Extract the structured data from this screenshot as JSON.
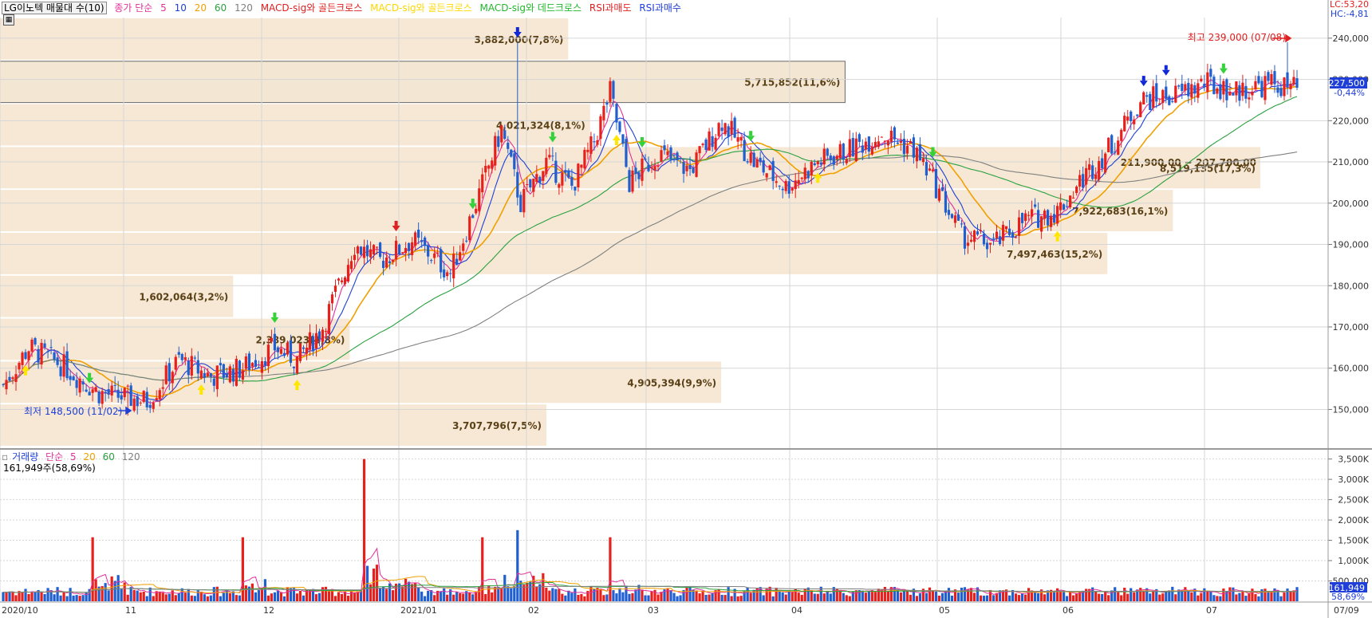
{
  "legend": {
    "stock": "LG이노텍 매물대 수(10)",
    "ma_label": "종가 단순",
    "ma_periods": [
      "5",
      "10",
      "20",
      "60",
      "120"
    ],
    "ma_colors": [
      "#e0309a",
      "#1f3fd8",
      "#f0a000",
      "#2aa040",
      "#808080"
    ],
    "sig1": "MACD-sig와 골든크로스",
    "sig2": "MACD-sig와 골든크로스",
    "sig3": "MACD-sig와 데드크로스",
    "sig4": "RSI과매도",
    "sig5": "RSI과매수"
  },
  "right_info": {
    "lc": "LC:53,20",
    "hc": "HC:-4,81"
  },
  "current": {
    "price": "227,500",
    "change": "-0,44%"
  },
  "annotations": {
    "high": "최고 239,000 (07/08)",
    "low": "최저 148,500 (11/02)"
  },
  "volume_legend": {
    "title": "거래량",
    "ma_label": "단순",
    "periods": [
      "5",
      "20",
      "60",
      "120"
    ],
    "info": "161,949주(58,69%)",
    "current": "161,949",
    "current_pct": "58,69%"
  },
  "chart_data": {
    "type": "candlestick",
    "title": "LG이노텍 매물대 수(10)",
    "price_axis": {
      "range": [
        141000,
        245000
      ],
      "ticks": [
        150000,
        160000,
        170000,
        180000,
        190000,
        200000,
        210000,
        220000,
        230000,
        240000
      ],
      "tick_labels": [
        "150,000",
        "160,000",
        "170,000",
        "180,000",
        "190,000",
        "200,000",
        "210,000",
        "220,000",
        "230,000",
        "240,000"
      ]
    },
    "volume_axis": {
      "range": [
        0,
        3650000
      ],
      "ticks": [
        500000,
        1000000,
        1500000,
        2000000,
        2500000,
        3000000,
        3500000
      ],
      "tick_labels": [
        "500,000",
        "1,000K",
        "1,500K",
        "2,000K",
        "2,500K",
        "3,000K",
        "3,500K"
      ]
    },
    "x_labels": [
      "2020/10",
      "11",
      "12",
      "2021/01",
      "02",
      "03",
      "04",
      "05",
      "06",
      "07",
      "07/09"
    ],
    "volume_profile": [
      {
        "low": 141000,
        "high": 151400,
        "label": "3,707,796(7,5%)"
      },
      {
        "low": 151400,
        "high": 161800,
        "label": "4,905,394(9,9%)"
      },
      {
        "low": 161800,
        "high": 172200,
        "label": "2,389,023(4,8%)"
      },
      {
        "low": 172200,
        "high": 182600,
        "label": "1,602,064(3,2%)"
      },
      {
        "low": 182600,
        "high": 193000,
        "label": "7,497,463(15,2%)"
      },
      {
        "low": 193000,
        "high": 203400,
        "label": "7,922,683(16,1%)"
      },
      {
        "low": 203400,
        "high": 213800,
        "label": "8,519,135(17,3%)"
      },
      {
        "low": 213800,
        "high": 224200,
        "label": "4,021,324(8,1%)"
      },
      {
        "low": 224200,
        "high": 234600,
        "label": "5,715,852(11,6%)"
      },
      {
        "low": 234600,
        "high": 245000,
        "label": "3,882,000(7,8%)"
      }
    ],
    "dominant_band": "211,900,00 ~ 207,700,00",
    "price_waypoints": [
      [
        0,
        156000
      ],
      [
        8,
        165000
      ],
      [
        18,
        161000
      ],
      [
        30,
        154000
      ],
      [
        45,
        152000
      ],
      [
        55,
        162000
      ],
      [
        65,
        158000
      ],
      [
        75,
        160000
      ],
      [
        85,
        165000
      ],
      [
        92,
        162000
      ],
      [
        100,
        170000
      ],
      [
        104,
        178000
      ],
      [
        110,
        190000
      ],
      [
        118,
        186000
      ],
      [
        128,
        191000
      ],
      [
        133,
        188000
      ],
      [
        140,
        183000
      ],
      [
        148,
        200000
      ],
      [
        156,
        218000
      ],
      [
        162,
        200000
      ],
      [
        170,
        210000
      ],
      [
        178,
        204000
      ],
      [
        185,
        215000
      ],
      [
        190,
        227000
      ],
      [
        196,
        205000
      ],
      [
        205,
        212000
      ],
      [
        215,
        208000
      ],
      [
        225,
        220000
      ],
      [
        235,
        210000
      ],
      [
        245,
        204000
      ],
      [
        255,
        210000
      ],
      [
        265,
        213000
      ],
      [
        275,
        217000
      ],
      [
        285,
        213000
      ],
      [
        290,
        207000
      ],
      [
        300,
        192000
      ],
      [
        310,
        190000
      ],
      [
        320,
        196000
      ],
      [
        330,
        198000
      ],
      [
        338,
        206000
      ],
      [
        348,
        215000
      ],
      [
        356,
        225000
      ],
      [
        366,
        226000
      ],
      [
        376,
        229000
      ],
      [
        386,
        227000
      ],
      [
        396,
        229000
      ],
      [
        405,
        227500
      ]
    ],
    "candle_count": 406,
    "volume_spikes": [
      [
        28,
        11,
        2.3
      ],
      [
        75,
        8,
        2.0
      ],
      [
        113,
        8,
        3.5
      ],
      [
        117,
        15,
        2.1
      ],
      [
        150,
        10,
        1.4
      ],
      [
        157,
        8,
        1.7
      ],
      [
        161,
        10,
        2.6
      ],
      [
        190,
        10,
        1.5
      ]
    ],
    "ma_lines": [
      {
        "name": "MA5",
        "color": "#e0309a"
      },
      {
        "name": "MA10",
        "color": "#1f3fd8"
      },
      {
        "name": "MA20",
        "color": "#f0a000"
      },
      {
        "name": "MA60",
        "color": "#2aa040"
      },
      {
        "name": "MA120",
        "color": "#808080"
      }
    ],
    "signals": [
      {
        "type": "macd-golden",
        "color": "#ffe600",
        "bar": 7
      },
      {
        "type": "macd-golden",
        "color": "#ffe600",
        "bar": 62
      },
      {
        "type": "macd-golden",
        "color": "#ffe600",
        "bar": 92
      },
      {
        "type": "macd-golden",
        "color": "#ffe600",
        "bar": 192
      },
      {
        "type": "macd-golden",
        "color": "#ffe600",
        "bar": 255
      },
      {
        "type": "macd-golden",
        "color": "#ffe600",
        "bar": 330
      },
      {
        "type": "macd-dead",
        "color": "#33d13a",
        "bar": 27
      },
      {
        "type": "macd-dead",
        "color": "#33d13a",
        "bar": 85
      },
      {
        "type": "macd-dead",
        "color": "#33d13a",
        "bar": 147
      },
      {
        "type": "macd-dead",
        "color": "#33d13a",
        "bar": 172
      },
      {
        "type": "macd-dead",
        "color": "#33d13a",
        "bar": 200
      },
      {
        "type": "macd-dead",
        "color": "#33d13a",
        "bar": 234
      },
      {
        "type": "macd-dead",
        "color": "#33d13a",
        "bar": 291
      },
      {
        "type": "macd-dead",
        "color": "#33d13a",
        "bar": 382
      },
      {
        "type": "rsi-oversold",
        "color": "#e02020",
        "bar": 123
      },
      {
        "type": "rsi-overbought",
        "color": "#1028d8",
        "bar": 161
      },
      {
        "type": "rsi-overbought",
        "color": "#1028d8",
        "bar": 357
      },
      {
        "type": "rsi-overbought",
        "color": "#1028d8",
        "bar": 364
      }
    ]
  }
}
